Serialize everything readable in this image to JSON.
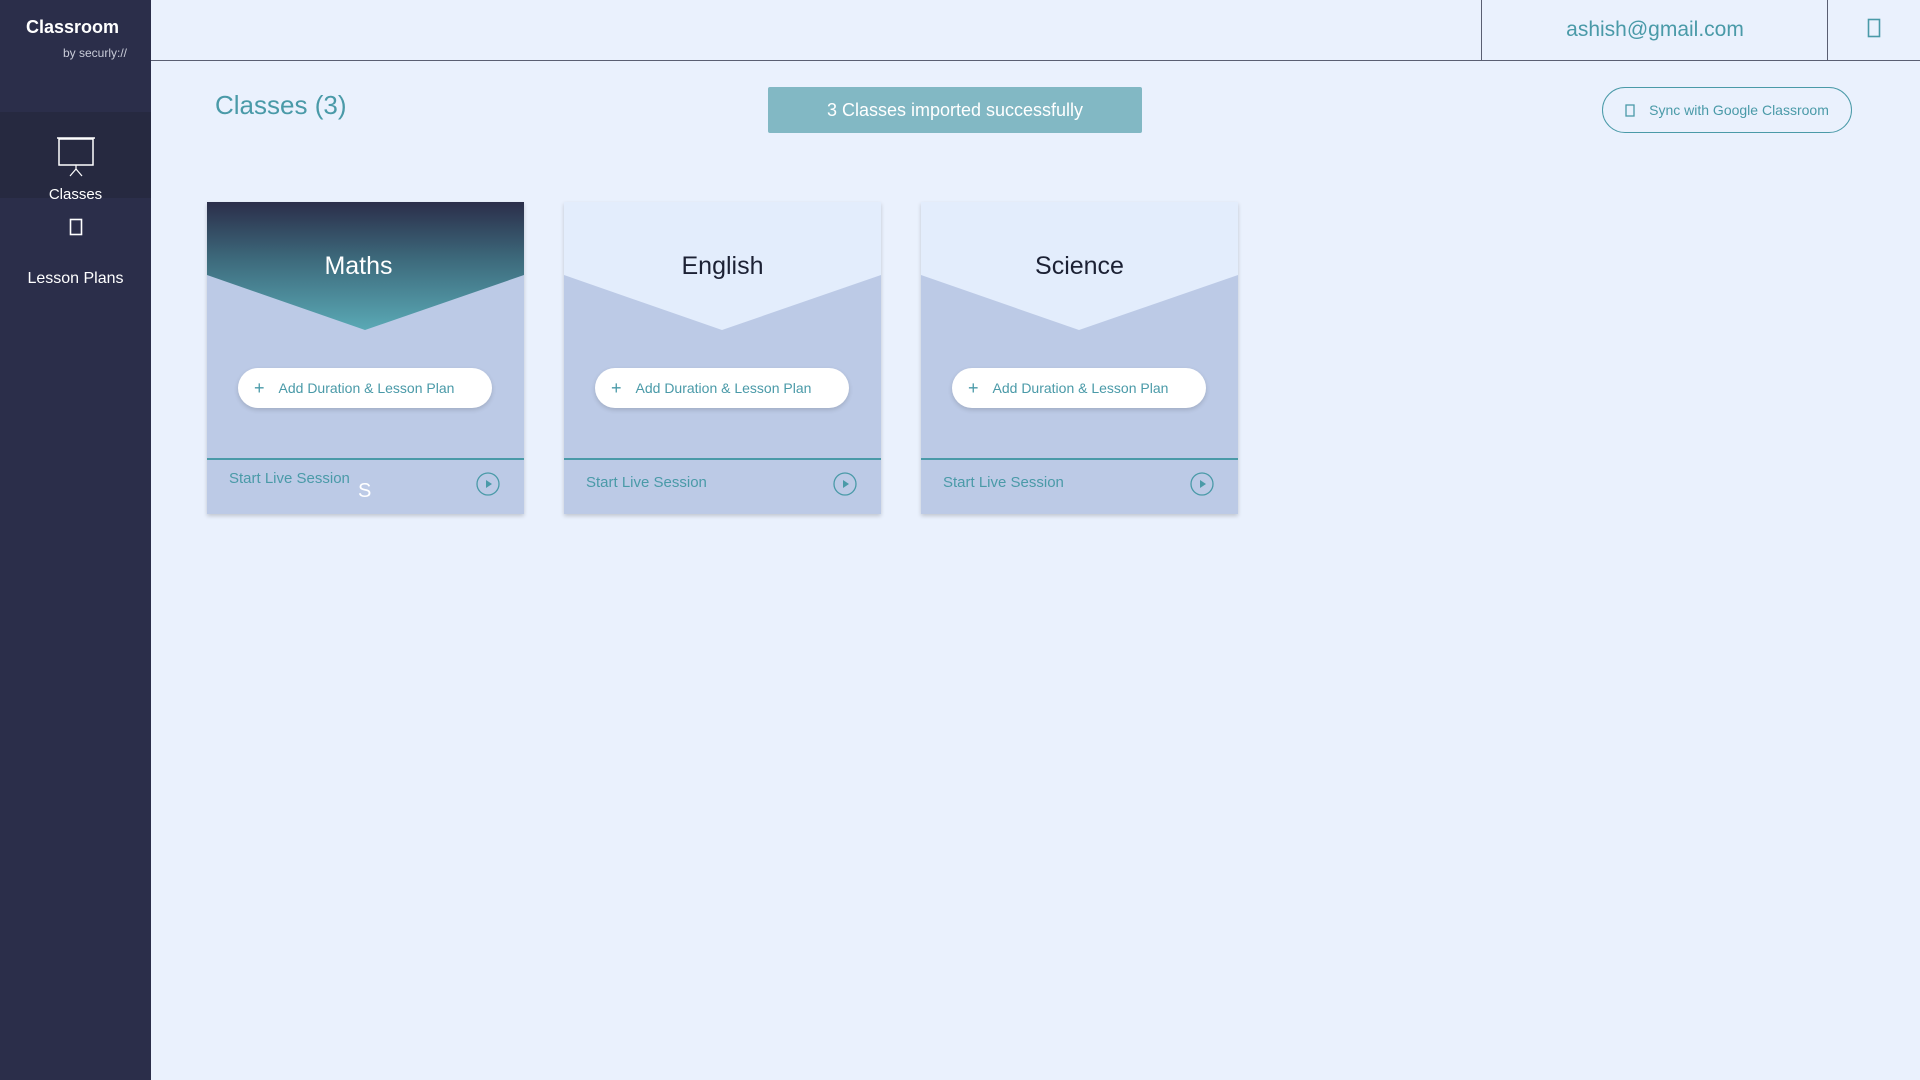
{
  "brand": {
    "title": "Classroom",
    "subtitle": "by securly://"
  },
  "sidebar": {
    "items": [
      {
        "label": "Classes",
        "icon": "presentation-board-icon",
        "active": true
      },
      {
        "label": "Lesson Plans",
        "icon": "document-icon",
        "active": false
      }
    ]
  },
  "header": {
    "user_email": "ashish@gmail.com",
    "menu_icon": "menu-icon"
  },
  "main": {
    "title": "Classes (3)",
    "toast": "3 Classes imported successfully",
    "sync_label": "Sync with Google Classroom",
    "cards": [
      {
        "name": "Maths",
        "add_label": "Add Duration & Lesson Plan",
        "start_label": "Start Live Session",
        "overlay_text": "S"
      },
      {
        "name": "English",
        "add_label": "Add Duration & Lesson Plan",
        "start_label": "Start Live Session"
      },
      {
        "name": "Science",
        "add_label": "Add Duration & Lesson Plan",
        "start_label": "Start Live Session"
      }
    ]
  },
  "colors": {
    "sidebar": "#2b2e4a",
    "background": "#eaf1fd",
    "accent": "#4a9aa8",
    "toast": "#82b8c4",
    "card_body": "#bccae6",
    "card_light_top": "#e3edfc"
  }
}
